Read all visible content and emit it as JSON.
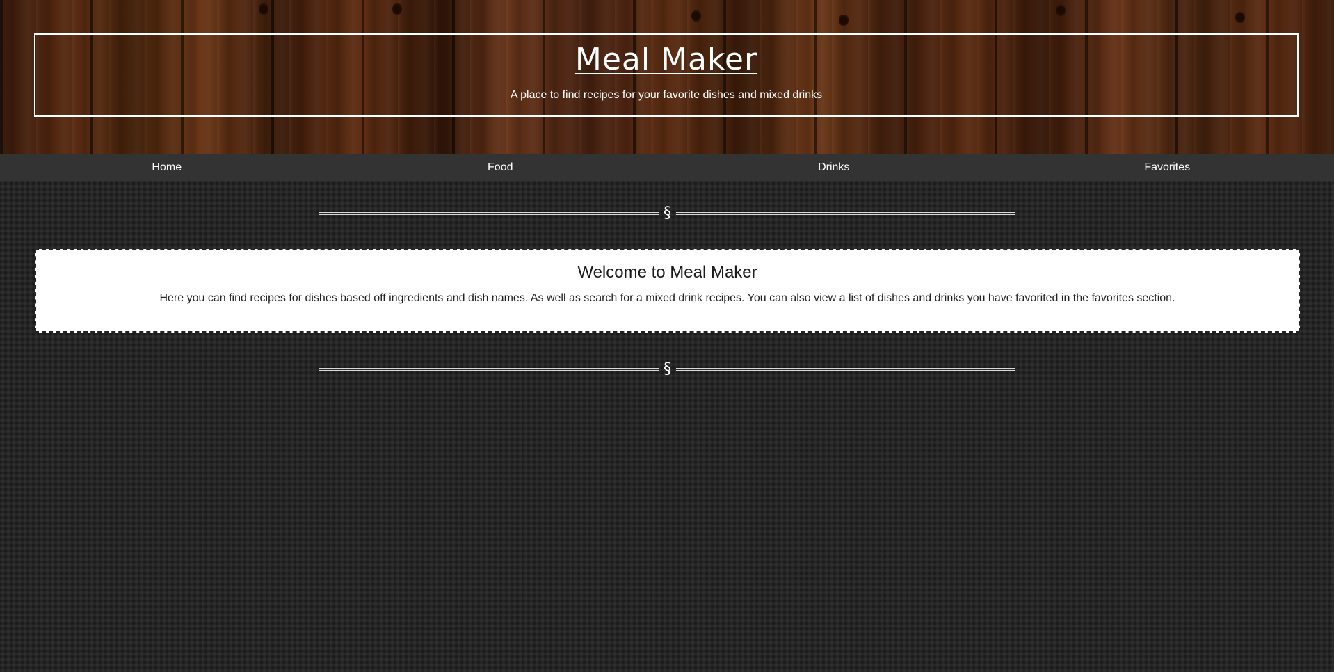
{
  "header": {
    "title": "Meal Maker",
    "tagline": "A place to find recipes for your favorite dishes and mixed drinks"
  },
  "nav": {
    "items": [
      {
        "label": "Home"
      },
      {
        "label": "Food"
      },
      {
        "label": "Drinks"
      },
      {
        "label": "Favorites"
      }
    ]
  },
  "divider": {
    "glyph": "§"
  },
  "welcome": {
    "title": "Welcome to Meal Maker",
    "text": "Here you can find recipes for dishes based off ingredients and dish names. As well as search for a mixed drink recipes. You can also view a list of dishes and drinks you have favorited in the favorites section."
  },
  "colors": {
    "nav_background": "#333333",
    "page_background": "#262626",
    "card_background": "#ffffff"
  }
}
